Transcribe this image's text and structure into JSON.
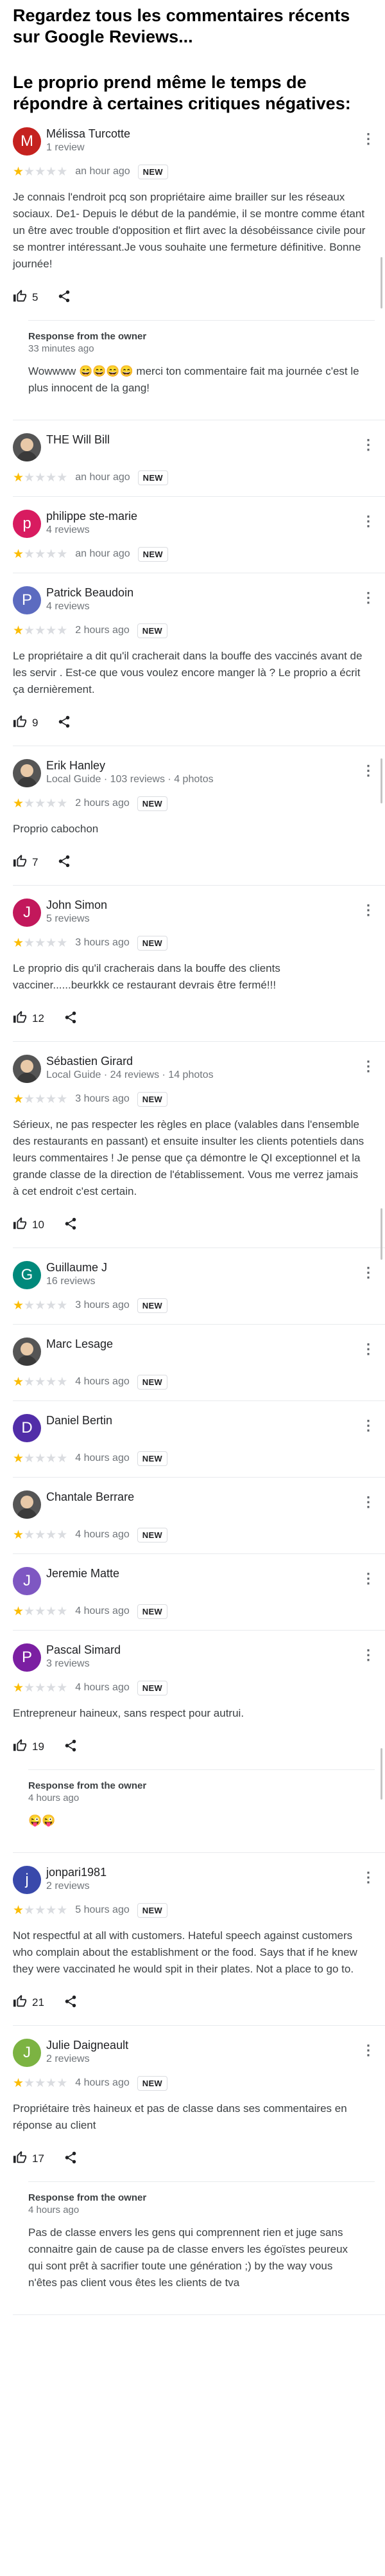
{
  "headline": {
    "line1": "Regardez tous les commentaires récents sur Google Reviews...",
    "line2": "Le proprio prend même le temps de répondre à certaines critiques négatives:"
  },
  "colors": {
    "star": "#fbbc04",
    "star_empty": "#dadce0"
  },
  "icons": {
    "more": "more-vert-icon",
    "like": "thumb-up-icon",
    "share": "share-icon"
  },
  "reviews": [
    {
      "initial": "M",
      "avatar_color": "#c5221f",
      "name": "Mélissa Turcotte",
      "meta": "1 review",
      "rating": 1,
      "time": "an hour ago",
      "badge": "NEW",
      "text": "Je connais l'endroit pcq son propriétaire aime brailler sur les réseaux sociaux. De1- Depuis le début de la pandémie, il se montre comme étant un être avec trouble d'opposition et flirt avec la désobéissance civile pour se montrer intéressant.Je vous souhaite une fermeture définitive. Bonne journée!",
      "likes": "5",
      "owner": {
        "title": "Response from the owner",
        "time": "33 minutes ago",
        "text": "Wowwww 😄😄😄😄 merci ton commentaire fait ma journée c'est le plus innocent de la gang!"
      }
    },
    {
      "initial": "",
      "avatar_color": "#555555",
      "photo": true,
      "name": "THE Will Bill",
      "meta": "",
      "rating": 1,
      "time": "an hour ago",
      "badge": "NEW"
    },
    {
      "initial": "p",
      "avatar_color": "#d81b60",
      "name": "philippe ste-marie",
      "meta": "4 reviews",
      "rating": 1,
      "time": "an hour ago",
      "badge": "NEW"
    },
    {
      "initial": "P",
      "avatar_color": "#5c6bc0",
      "name": "Patrick Beaudoin",
      "meta": "4 reviews",
      "rating": 1,
      "time": "2 hours ago",
      "badge": "NEW",
      "text": "Le propriétaire a dit qu'il cracherait dans la bouffe des vaccinés avant de les servir . Est-ce que vous voulez encore manger là ? Le proprio a écrit ça dernièrement.",
      "likes": "9"
    },
    {
      "initial": "",
      "avatar_color": "#555555",
      "photo": true,
      "name": "Erik Hanley",
      "meta": "Local Guide · 103 reviews · 4 photos",
      "rating": 1,
      "time": "2 hours ago",
      "badge": "NEW",
      "text": "Proprio cabochon",
      "likes": "7"
    },
    {
      "initial": "J",
      "avatar_color": "#c2185b",
      "name": "John Simon",
      "meta": "5 reviews",
      "rating": 1,
      "time": "3 hours ago",
      "badge": "NEW",
      "text": "Le proprio dis qu'il cracherais dans la bouffe des clients vacciner......beurkkk ce restaurant devrais être fermé!!!",
      "likes": "12"
    },
    {
      "initial": "",
      "avatar_color": "#555555",
      "photo": true,
      "name": "Sébastien Girard",
      "meta": "Local Guide · 24 reviews · 14 photos",
      "rating": 1,
      "time": "3 hours ago",
      "badge": "NEW",
      "text": "Sérieux, ne pas respecter les règles en place (valables dans l'ensemble des restaurants en passant) et ensuite insulter les clients potentiels dans leurs commentaires ! Je pense que ça démontre le QI exceptionnel et la grande classe de la direction de l'établissement. Vous me verrez jamais à cet endroit c'est certain.",
      "likes": "10"
    },
    {
      "initial": "G",
      "avatar_color": "#00897b",
      "name": "Guillaume J",
      "meta": "16 reviews",
      "rating": 1,
      "time": "3 hours ago",
      "badge": "NEW"
    },
    {
      "initial": "",
      "avatar_color": "#555555",
      "photo": true,
      "name": "Marc Lesage",
      "meta": "",
      "rating": 1,
      "time": "4 hours ago",
      "badge": "NEW"
    },
    {
      "initial": "D",
      "avatar_color": "#512da8",
      "name": "Daniel Bertin",
      "meta": "",
      "rating": 1,
      "time": "4 hours ago",
      "badge": "NEW"
    },
    {
      "initial": "",
      "avatar_color": "#555555",
      "photo": true,
      "name": "Chantale Berrare",
      "meta": "",
      "rating": 1,
      "time": "4 hours ago",
      "badge": "NEW"
    },
    {
      "initial": "J",
      "avatar_color": "#7e57c2",
      "name": "Jeremie Matte",
      "meta": "",
      "rating": 1,
      "time": "4 hours ago",
      "badge": "NEW"
    },
    {
      "initial": "P",
      "avatar_color": "#7b1fa2",
      "name": "Pascal Simard",
      "meta": "3 reviews",
      "rating": 1,
      "time": "4 hours ago",
      "badge": "NEW",
      "text": "Entrepreneur haineux, sans respect pour autrui.",
      "likes": "19",
      "owner": {
        "title": "Response from the owner",
        "time": "4 hours ago",
        "text": "😜😜"
      }
    },
    {
      "initial": "j",
      "avatar_color": "#3949ab",
      "name": "jonpari1981",
      "meta": "2 reviews",
      "rating": 1,
      "time": "5 hours ago",
      "badge": "NEW",
      "text": "Not respectful at all with customers. Hateful speech against customers who complain about the establishment or the food. Says that if he knew they were vaccinated he would spit in their plates. Not a place to go to.",
      "likes": "21"
    },
    {
      "initial": "J",
      "avatar_color": "#7cb342",
      "name": "Julie Daigneault",
      "meta": "2 reviews",
      "rating": 1,
      "time": "4 hours ago",
      "badge": "NEW",
      "text": "Propriétaire très haineux et pas de classe dans ses commentaires en réponse au client",
      "likes": "17",
      "owner": {
        "title": "Response from the owner",
        "time": "4 hours ago",
        "text": "Pas de classe envers les gens qui comprennent rien et juge sans connaitre gain de cause pa de classe envers les égoïstes peureux qui sont prêt à sacrifier toute une génération ;) by the way vous n'êtes pas client vous êtes les clients de tva"
      }
    }
  ]
}
